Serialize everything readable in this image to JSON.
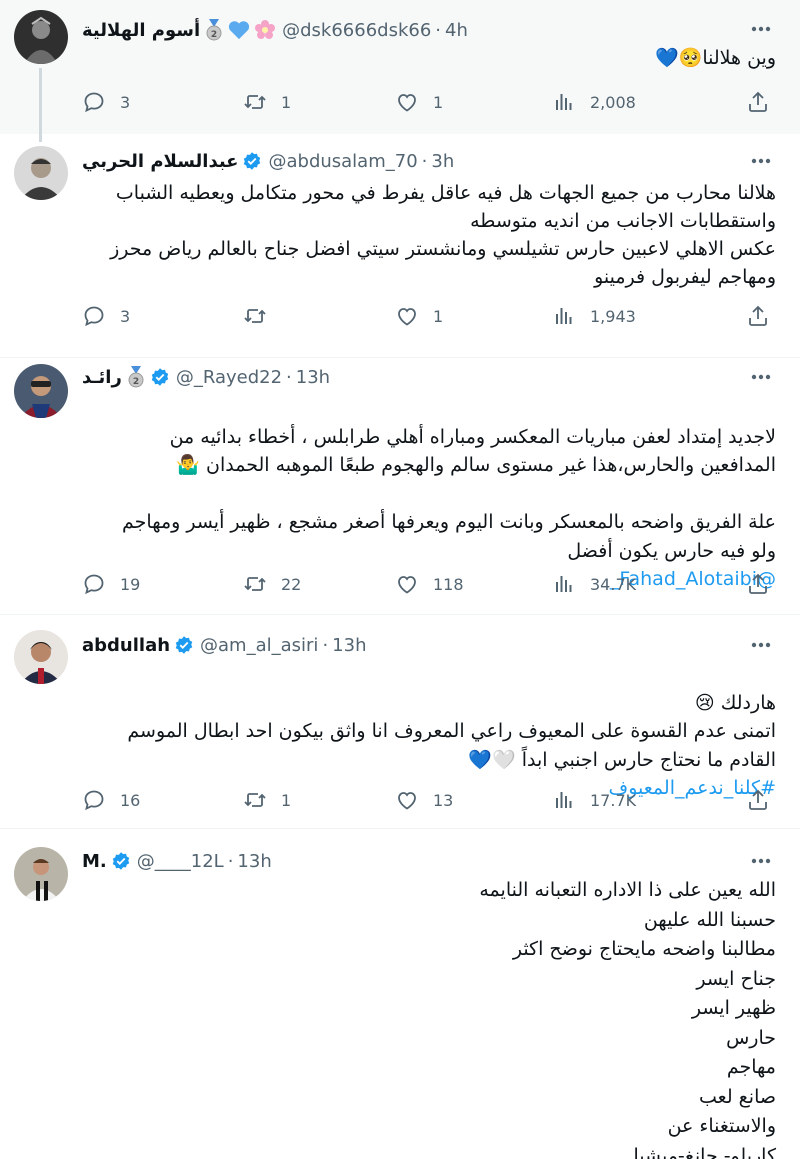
{
  "tweets": [
    {
      "display_name": "أسوم الهلالية",
      "handle": "@dsk6666dsk66",
      "time": "4h",
      "body": "وين هلالنا🥺💙",
      "replies": "3",
      "retweets": "1",
      "likes": "1",
      "views": "2,008"
    },
    {
      "display_name": "عبدالسلام الحربي",
      "handle": "@abdusalam_70",
      "time": "3h",
      "body": "هلالنا  محارب من جميع الجهات هل فيه عاقل  يفرط في محور متكامل ويعطيه الشباب\nواستقطابات الاجانب من انديه متوسطه\nعكس الاهلي  لاعبين حارس  تشيلسي ومانشستر سيتي افضل جناح بالعالم رياض محرز\nومهاجم ليفربول فرمينو",
      "replies": "3",
      "retweets": "",
      "likes": "1",
      "views": "1,943"
    },
    {
      "display_name": "رائـد",
      "handle": "@_Rayed22",
      "time": "13h",
      "body": "لاجديد إمتداد لعفن مباريات المعكسر ومباراه أهلي طرابلس ، أخطاء بدائيه من\nالمدافعين والحارس،هذا غير مستوى سالم والهجوم طبعًا الموهبه الحمدان 🤷‍♂️\n\nعلة الفريق واضحه بالمعسكر وبانت اليوم ويعرفها أصغر مشجع ، ظهير أيسر ومهاجم\nولو فيه حارس يكون أفضل",
      "link": "@Fahad_Alotaibi_",
      "replies": "19",
      "retweets": "22",
      "likes": "118",
      "views": "34.7K"
    },
    {
      "display_name": "abdullah",
      "handle": "@am_al_asiri",
      "time": "13h",
      "body": "هاردلك 😢\nاتمنى عدم القسوة على المعيوف راعي المعروف انا واثق بيكون احد ابطال الموسم\nالقادم ما نحتاج حارس اجنبي ابداً 🤍💙",
      "link": "#كلنا_ندعم_المعيوف",
      "replies": "16",
      "retweets": "1",
      "likes": "13",
      "views": "17.7K"
    },
    {
      "display_name": "M.",
      "handle": "@____12L",
      "time": "13h",
      "body": "الله يعين على ذا الاداره التعبانه النايمه\nحسبنا الله عليهن\nمطالبنا واضحه مايحتاج نوضح اكثر\nجناح ايسر\nظهير ايسر\nحارس\nمهاجم\nصانع لعب\nوالاستغناء عن\nكاريلو- جانغ-ميشيل"
    }
  ],
  "colors": {
    "accent": "#1d9bf0",
    "muted": "#536471",
    "text": "#0f1419"
  },
  "icons": [
    "more-icon",
    "reply-icon",
    "retweet-icon",
    "like-icon",
    "views-icon",
    "share-icon",
    "verified-icon",
    "medal-icon",
    "blue-heart-icon",
    "flower-icon"
  ]
}
